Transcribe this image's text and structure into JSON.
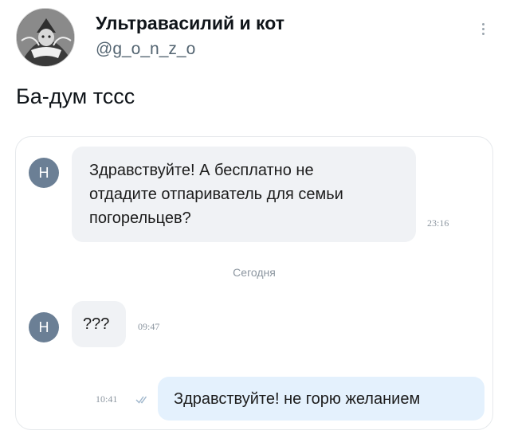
{
  "tweet": {
    "display_name": "Ультравасилий и кот",
    "handle": "@g_o_n_z_o",
    "text": "Ба-дум тссс"
  },
  "chat": {
    "contact_initial": "Н",
    "messages": [
      {
        "direction": "incoming",
        "lines": [
          "Здравствуйте! А бесплатно не",
          "отдадите отпариватель для семьи",
          "погорельцев?"
        ],
        "time": "23:16"
      },
      {
        "direction": "incoming",
        "lines": [
          "???"
        ],
        "time": "09:47"
      },
      {
        "direction": "outgoing",
        "lines": [
          "Здравствуйте! не горю желанием"
        ],
        "time": "10:41",
        "read": true
      }
    ],
    "date_separator": "Сегодня"
  },
  "icons": {
    "more": "more-vertical-icon",
    "read_receipt": "double-check-icon"
  },
  "colors": {
    "contact_avatar": "#6b7f95",
    "incoming_bubble": "#f0f2f5",
    "outgoing_bubble": "#e4f1fd",
    "check_color": "#9fb6cc"
  }
}
